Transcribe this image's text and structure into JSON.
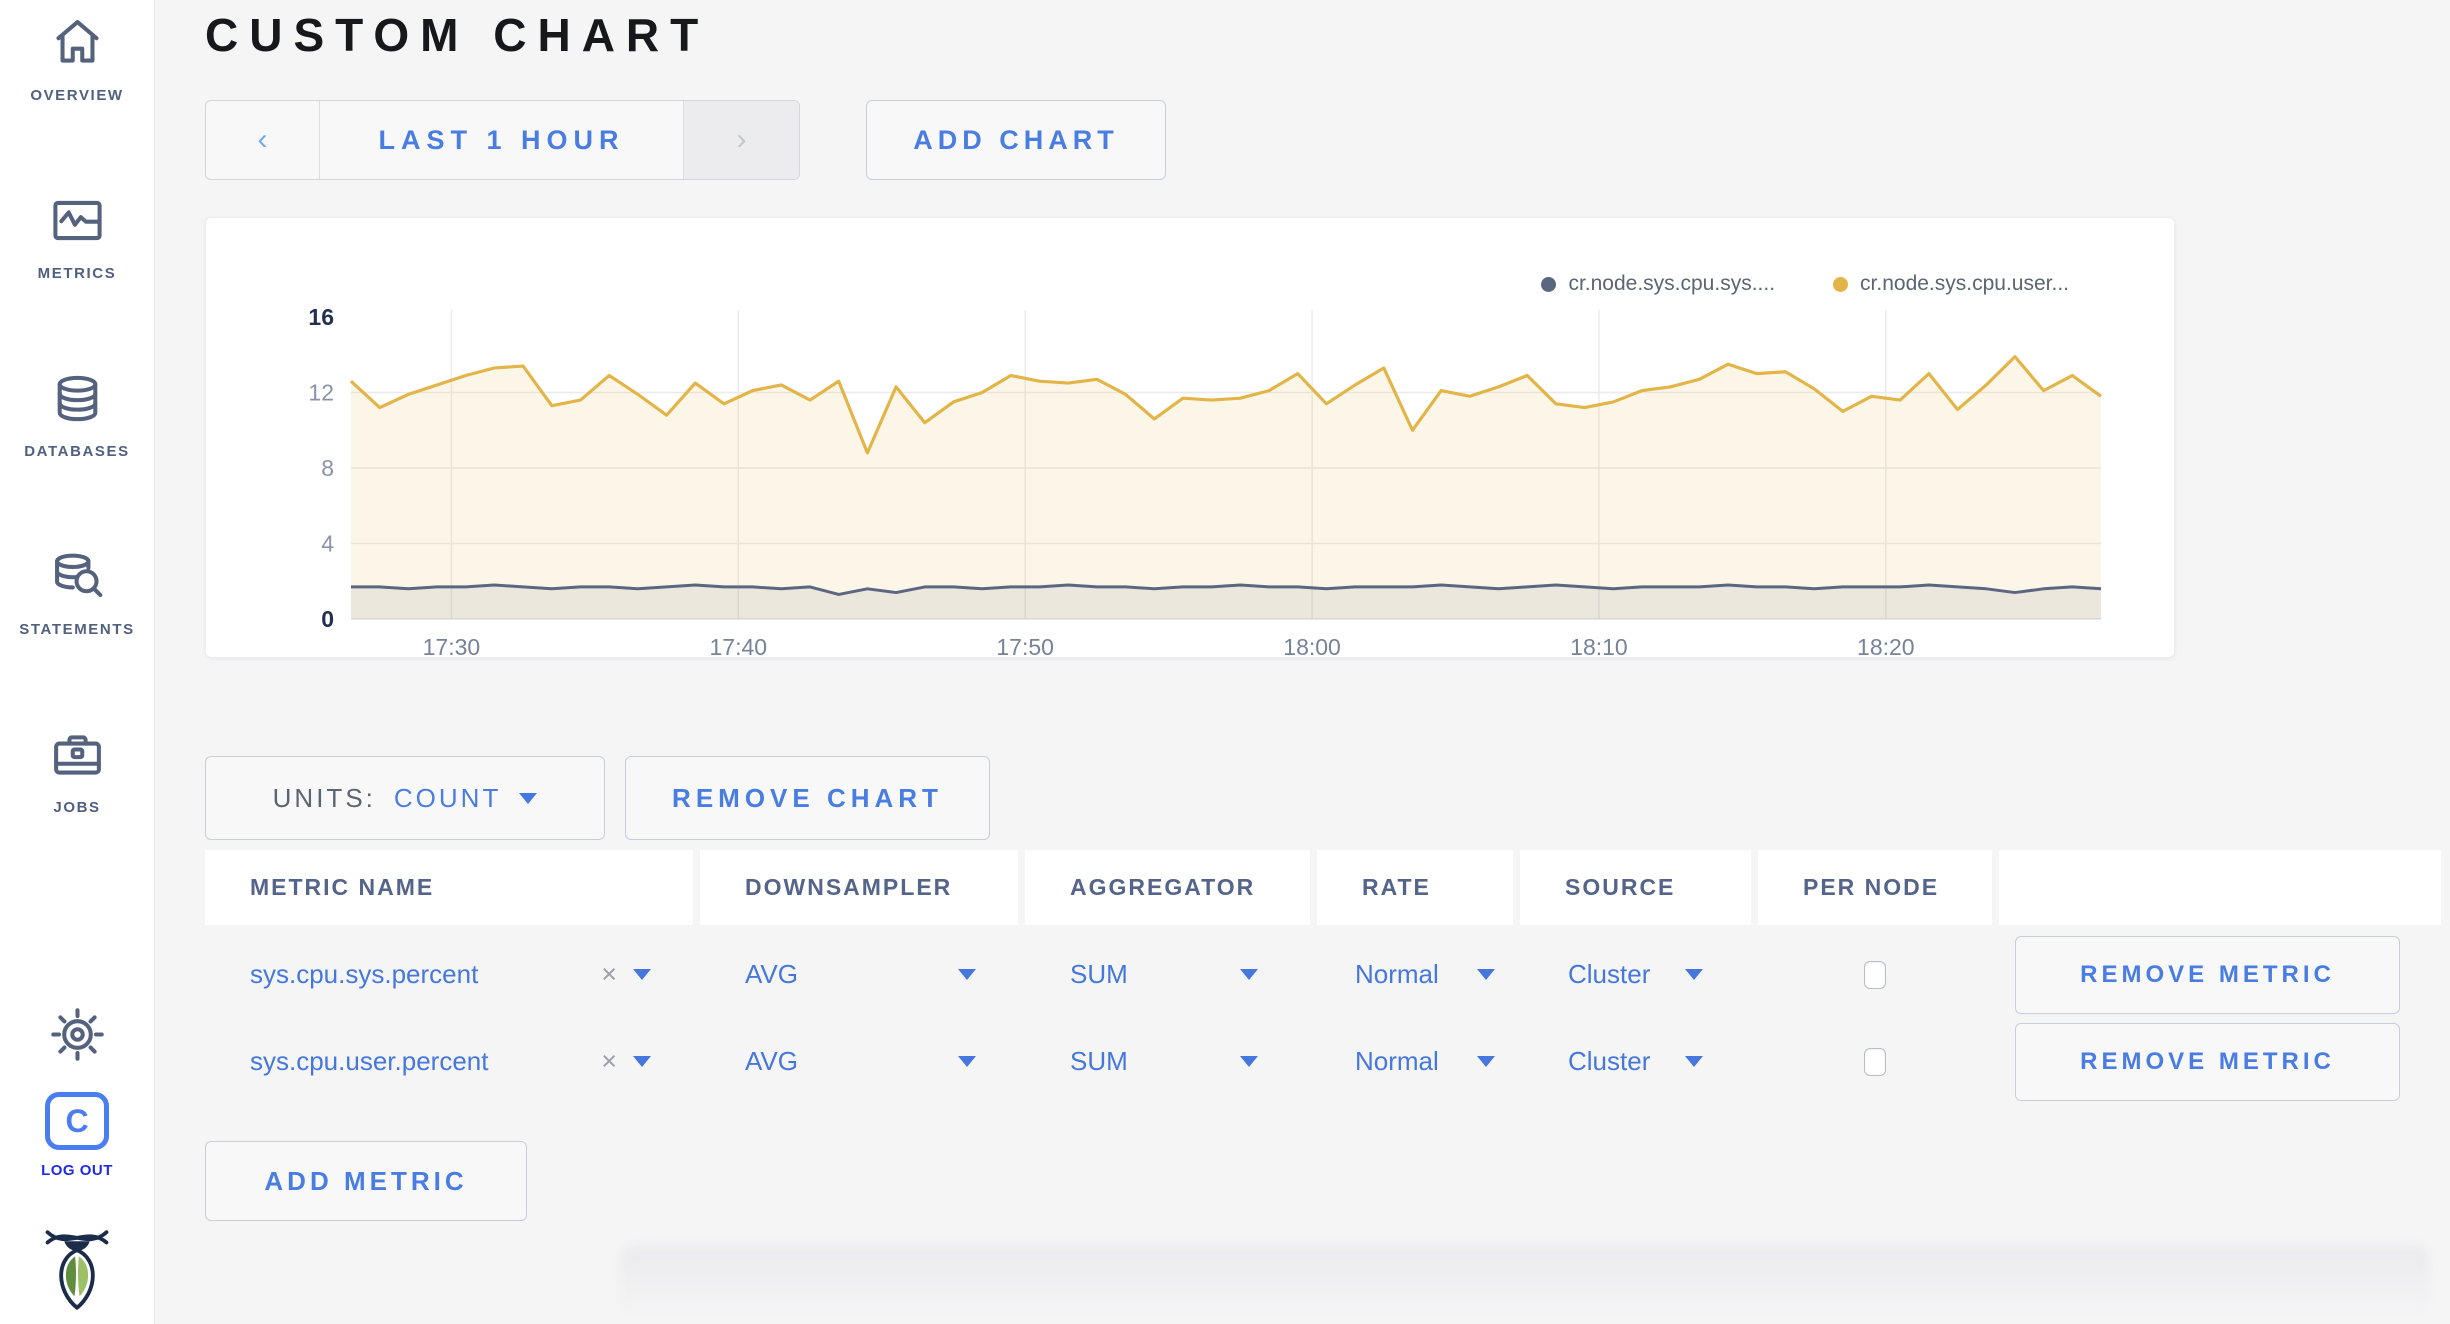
{
  "page": {
    "title": "CUSTOM CHART"
  },
  "sidebar": {
    "items": [
      {
        "label": "OVERVIEW"
      },
      {
        "label": "METRICS"
      },
      {
        "label": "DATABASES"
      },
      {
        "label": "STATEMENTS"
      },
      {
        "label": "JOBS"
      }
    ],
    "logout": {
      "label": "LOG OUT",
      "monogram": "C"
    }
  },
  "time_selector": {
    "prev": "‹",
    "label": "LAST 1 HOUR",
    "next": "›"
  },
  "actions": {
    "add_chart": "ADD CHART",
    "units_label": "UNITS:",
    "units_value": "COUNT",
    "remove_chart": "REMOVE CHART",
    "add_metric": "ADD METRIC"
  },
  "chart_data": {
    "type": "line",
    "title": "",
    "xlabel": "",
    "ylabel": "",
    "ylim": [
      0,
      16
    ],
    "grid": "on",
    "legend_position": "top-right",
    "y_ticks": [
      {
        "value": 16,
        "emphasis": true
      },
      {
        "value": 12,
        "emphasis": false
      },
      {
        "value": 8,
        "emphasis": false
      },
      {
        "value": 4,
        "emphasis": false
      },
      {
        "value": 0,
        "emphasis": true
      }
    ],
    "y_gridlines": [
      4,
      8,
      12
    ],
    "x_ticks": [
      {
        "label": "17:30",
        "minute": 3.5
      },
      {
        "label": "17:40",
        "minute": 13.5
      },
      {
        "label": "17:50",
        "minute": 23.5
      },
      {
        "label": "18:00",
        "minute": 33.5
      },
      {
        "label": "18:10",
        "minute": 43.5
      },
      {
        "label": "18:20",
        "minute": 53.5
      }
    ],
    "x_domain_minutes": [
      0,
      61
    ],
    "series": [
      {
        "name": "cr.node.sys.cpu.sys....",
        "color": "#5b6680",
        "fill": "rgba(91,102,128,0.10)",
        "values": [
          1.7,
          1.7,
          1.6,
          1.7,
          1.7,
          1.8,
          1.7,
          1.6,
          1.7,
          1.7,
          1.6,
          1.7,
          1.8,
          1.7,
          1.7,
          1.6,
          1.7,
          1.3,
          1.6,
          1.4,
          1.7,
          1.7,
          1.6,
          1.7,
          1.7,
          1.8,
          1.7,
          1.7,
          1.6,
          1.7,
          1.7,
          1.8,
          1.7,
          1.7,
          1.6,
          1.7,
          1.7,
          1.7,
          1.8,
          1.7,
          1.6,
          1.7,
          1.8,
          1.7,
          1.6,
          1.7,
          1.7,
          1.7,
          1.8,
          1.7,
          1.7,
          1.6,
          1.7,
          1.7,
          1.7,
          1.8,
          1.7,
          1.6,
          1.4,
          1.6,
          1.7,
          1.6
        ]
      },
      {
        "name": "cr.node.sys.cpu.user...",
        "color": "#e3b549",
        "fill": "rgba(231,186,77,0.13)",
        "values": [
          12.6,
          11.2,
          11.9,
          12.4,
          12.9,
          13.3,
          13.4,
          11.3,
          11.6,
          12.9,
          11.9,
          10.8,
          12.5,
          11.4,
          12.1,
          12.4,
          11.6,
          12.6,
          8.8,
          12.3,
          10.4,
          11.5,
          12.0,
          12.9,
          12.6,
          12.5,
          12.7,
          11.9,
          10.6,
          11.7,
          11.6,
          11.7,
          12.1,
          13.0,
          11.4,
          12.4,
          13.3,
          10.0,
          12.1,
          11.8,
          12.3,
          12.9,
          11.4,
          11.2,
          11.5,
          12.1,
          12.3,
          12.7,
          13.5,
          13.0,
          13.1,
          12.2,
          11.0,
          11.8,
          11.6,
          13.0,
          11.1,
          12.4,
          13.9,
          12.1,
          12.9,
          11.8
        ]
      }
    ]
  },
  "table": {
    "headers": [
      "METRIC NAME",
      "DOWNSAMPLER",
      "AGGREGATOR",
      "RATE",
      "SOURCE",
      "PER NODE",
      ""
    ],
    "rows": [
      {
        "metric_name": "sys.cpu.sys.percent",
        "clear": "×",
        "downsampler": "AVG",
        "aggregator": "SUM",
        "rate": "Normal",
        "source": "Cluster",
        "per_node_checked": false,
        "remove_label": "REMOVE METRIC"
      },
      {
        "metric_name": "sys.cpu.user.percent",
        "clear": "×",
        "downsampler": "AVG",
        "aggregator": "SUM",
        "rate": "Normal",
        "source": "Cluster",
        "per_node_checked": false,
        "remove_label": "REMOVE METRIC"
      }
    ]
  },
  "colors": {
    "accent_blue": "#4a7de2",
    "logout_blue": "#1f2de0",
    "series_yellow": "#e3b549",
    "series_slate": "#5b6680"
  }
}
